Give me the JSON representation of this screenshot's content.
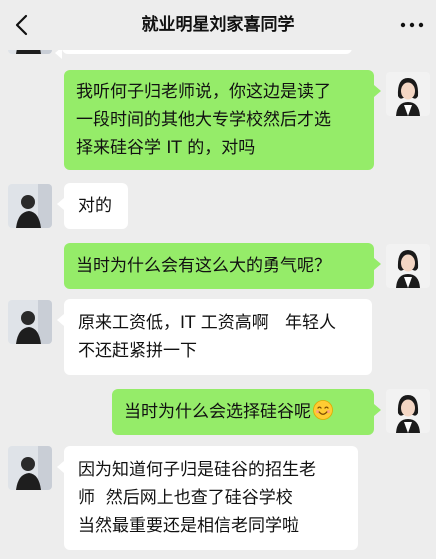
{
  "header": {
    "title": "就业明星刘家喜同学",
    "back_icon": "chevron-left-icon",
    "more_icon": "ellipsis-icon"
  },
  "messages": [
    {
      "side": "right",
      "lines": [
        "我听何子归老师说，你这边是读了",
        "一段时间的其他大专学校然后才选",
        "择来硅谷学 IT 的，对吗"
      ]
    },
    {
      "side": "left",
      "lines": [
        "对的"
      ]
    },
    {
      "side": "right",
      "lines": [
        "当时为什么会有这么大的勇气呢？"
      ]
    },
    {
      "side": "left",
      "lines": [
        "原来工资低，IT 工资高啊   年轻人",
        "不还赶紧拼一下"
      ]
    },
    {
      "side": "right",
      "lines": [
        "当时为什么会选择硅谷呢"
      ],
      "emoji": "smiling-face-icon"
    },
    {
      "side": "left",
      "lines": [
        "因为知道何子归是硅谷的招生老",
        "师  然后网上也查了硅谷学校",
        "当然最重要还是相信老同学啦"
      ]
    }
  ],
  "colors": {
    "background": "#ededed",
    "sent_bubble": "#95ec69",
    "received_bubble": "#ffffff"
  }
}
